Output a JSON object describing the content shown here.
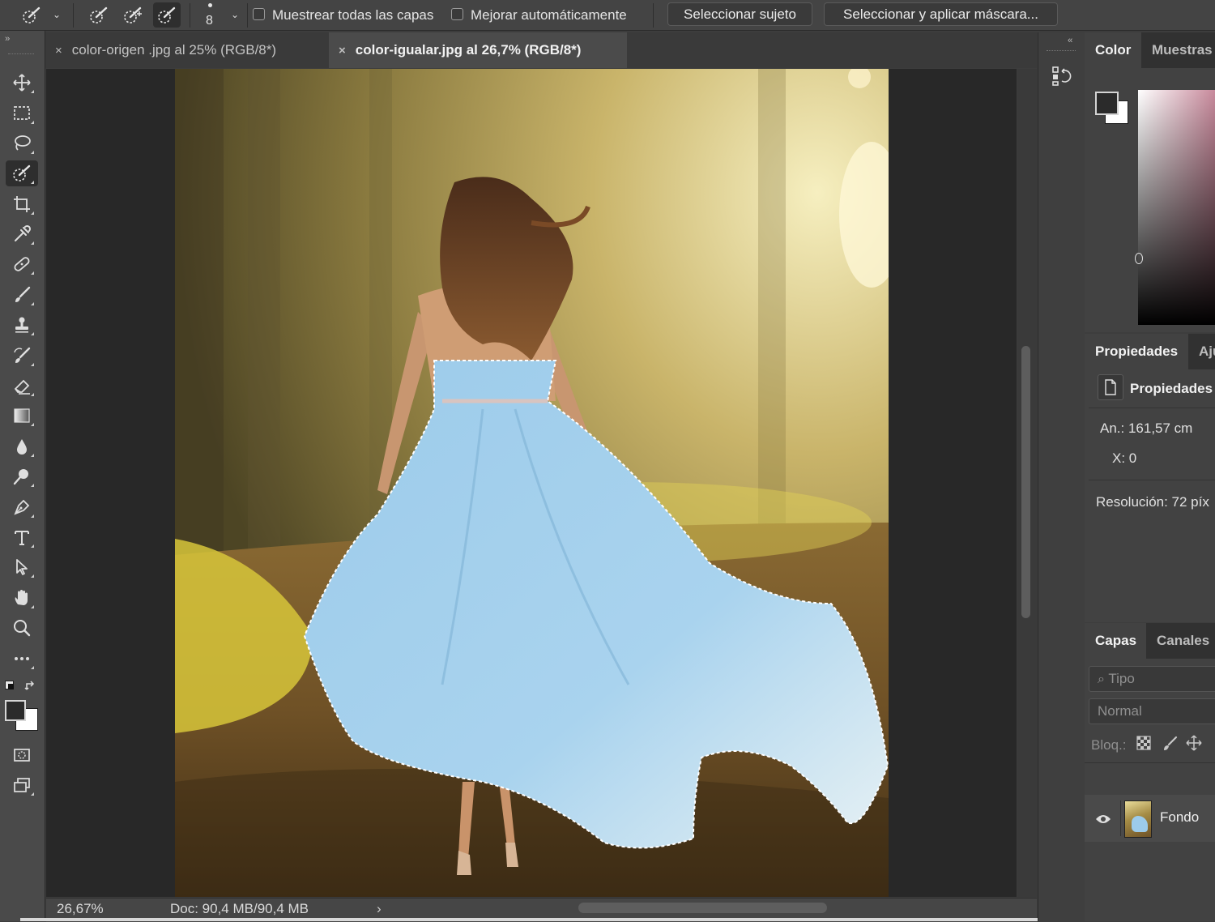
{
  "options_bar": {
    "brush_size": "8",
    "sample_all_layers": "Muestrear todas las capas",
    "auto_enhance": "Mejorar automáticamente",
    "select_subject": "Seleccionar sujeto",
    "select_and_mask": "Seleccionar y aplicar máscara..."
  },
  "tabs": [
    {
      "label": "color-origen .jpg al 25% (RGB/8*)",
      "active": false
    },
    {
      "label": "color-igualar.jpg al 26,7% (RGB/8*)",
      "active": true
    }
  ],
  "tools": [
    "move",
    "rectangular-marquee",
    "lasso",
    "quick-selection",
    "crop",
    "eyedropper",
    "spot-healing-brush",
    "brush",
    "clone-stamp",
    "history-brush",
    "eraser",
    "gradient",
    "blur",
    "dodge",
    "pen",
    "type",
    "path-selection",
    "hand",
    "zoom",
    "more"
  ],
  "status": {
    "zoom": "26,67%",
    "doc": "Doc: 90,4 MB/90,4 MB"
  },
  "color_panel": {
    "tabs": [
      "Color",
      "Muestras"
    ],
    "foreground_color": "#2b2b2b",
    "background_color": "#ffffff"
  },
  "properties_panel": {
    "tabs": [
      "Propiedades",
      "Aju"
    ],
    "header": "Propiedades",
    "width": "An.: 161,57 cm",
    "x": "X: 0",
    "resolution": "Resolución: 72 píx"
  },
  "layers_panel": {
    "tabs": [
      "Capas",
      "Canales"
    ],
    "filter_placeholder": "Tipo",
    "blend_mode": "Normal",
    "lock_label": "Bloq.:",
    "layer_name": "Fondo"
  },
  "colors": {
    "dress": "#a6d2ee",
    "light": "#f3e49a",
    "ground": "#7a5a2e"
  }
}
